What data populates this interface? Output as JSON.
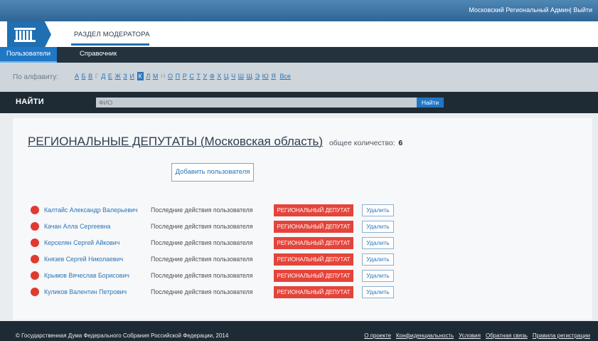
{
  "topbar": {
    "user": "Московский Региональный Админ",
    "separator": "|",
    "logout": "Выйти"
  },
  "header": {
    "section_title": "РАЗДЕЛ МОДЕРАТОРА"
  },
  "tabs": [
    {
      "label": "Пользователи",
      "active": true
    },
    {
      "label": "Справочник",
      "active": false
    }
  ],
  "alphabet": {
    "label": "По алфавиту:",
    "letters": [
      {
        "l": "А",
        "state": "link"
      },
      {
        "l": "Б",
        "state": "link"
      },
      {
        "l": "В",
        "state": "link"
      },
      {
        "l": "Г",
        "state": "dim"
      },
      {
        "l": "Д",
        "state": "link"
      },
      {
        "l": "Е",
        "state": "link"
      },
      {
        "l": "Ж",
        "state": "link"
      },
      {
        "l": "З",
        "state": "link"
      },
      {
        "l": "И",
        "state": "link"
      },
      {
        "l": "К",
        "state": "active"
      },
      {
        "l": "Л",
        "state": "link"
      },
      {
        "l": "М",
        "state": "link"
      },
      {
        "l": "Н",
        "state": "dim"
      },
      {
        "l": "О",
        "state": "link"
      },
      {
        "l": "П",
        "state": "link"
      },
      {
        "l": "Р",
        "state": "link"
      },
      {
        "l": "С",
        "state": "link"
      },
      {
        "l": "Т",
        "state": "link"
      },
      {
        "l": "У",
        "state": "link"
      },
      {
        "l": "Ф",
        "state": "link"
      },
      {
        "l": "Х",
        "state": "link"
      },
      {
        "l": "Ц",
        "state": "link"
      },
      {
        "l": "Ч",
        "state": "link"
      },
      {
        "l": "Ш",
        "state": "link"
      },
      {
        "l": "Щ",
        "state": "link"
      },
      {
        "l": "Э",
        "state": "link"
      },
      {
        "l": "Ю",
        "state": "link"
      },
      {
        "l": "Я",
        "state": "link"
      }
    ],
    "all_label": "Все"
  },
  "search": {
    "title": "НАЙТИ",
    "placeholder": "ФИО",
    "button": "Найти"
  },
  "main": {
    "title": "РЕГИОНАЛЬНЫЕ ДЕПУТАТЫ (Московская область)",
    "count_label": "общее количество:",
    "count_value": "6",
    "add_button": "Добавить пользователя"
  },
  "users": [
    {
      "name": "Калтайс Александр Валерьевич",
      "action": "Последние действия пользователя",
      "role": "РЕГИОНАЛЬНЫЙ ДЕПУТАТ",
      "delete": "Удалить"
    },
    {
      "name": "Качан Алла Сергеевна",
      "action": "Последние действия пользователя",
      "role": "РЕГИОНАЛЬНЫЙ ДЕПУТАТ",
      "delete": "Удалить"
    },
    {
      "name": "Керселян Сергей Айкович",
      "action": "Последние действия пользователя",
      "role": "РЕГИОНАЛЬНЫЙ ДЕПУТАТ",
      "delete": "Удалить"
    },
    {
      "name": "Князев Сергей Николаевич",
      "action": "Последние действия пользователя",
      "role": "РЕГИОНАЛЬНЫЙ ДЕПУТАТ",
      "delete": "Удалить"
    },
    {
      "name": "Крымов Вячеслав Борисович",
      "action": "Последние действия пользователя",
      "role": "РЕГИОНАЛЬНЫЙ ДЕПУТАТ",
      "delete": "Удалить"
    },
    {
      "name": "Куликов Валентин Петрович",
      "action": "Последние действия пользователя",
      "role": "РЕГИОНАЛЬНЫЙ ДЕПУТАТ",
      "delete": "Удалить"
    }
  ],
  "footer": {
    "copyright": "© Государственная Дума Федерального Собрания Российской Федерации, 2014",
    "links": [
      "О проекте",
      "Конфиденциальность",
      "Условия",
      "Обратная связь",
      "Правила регистрации"
    ]
  },
  "colors": {
    "accent": "#1f77c6",
    "danger": "#e5443a",
    "dark": "#1f2b34"
  }
}
